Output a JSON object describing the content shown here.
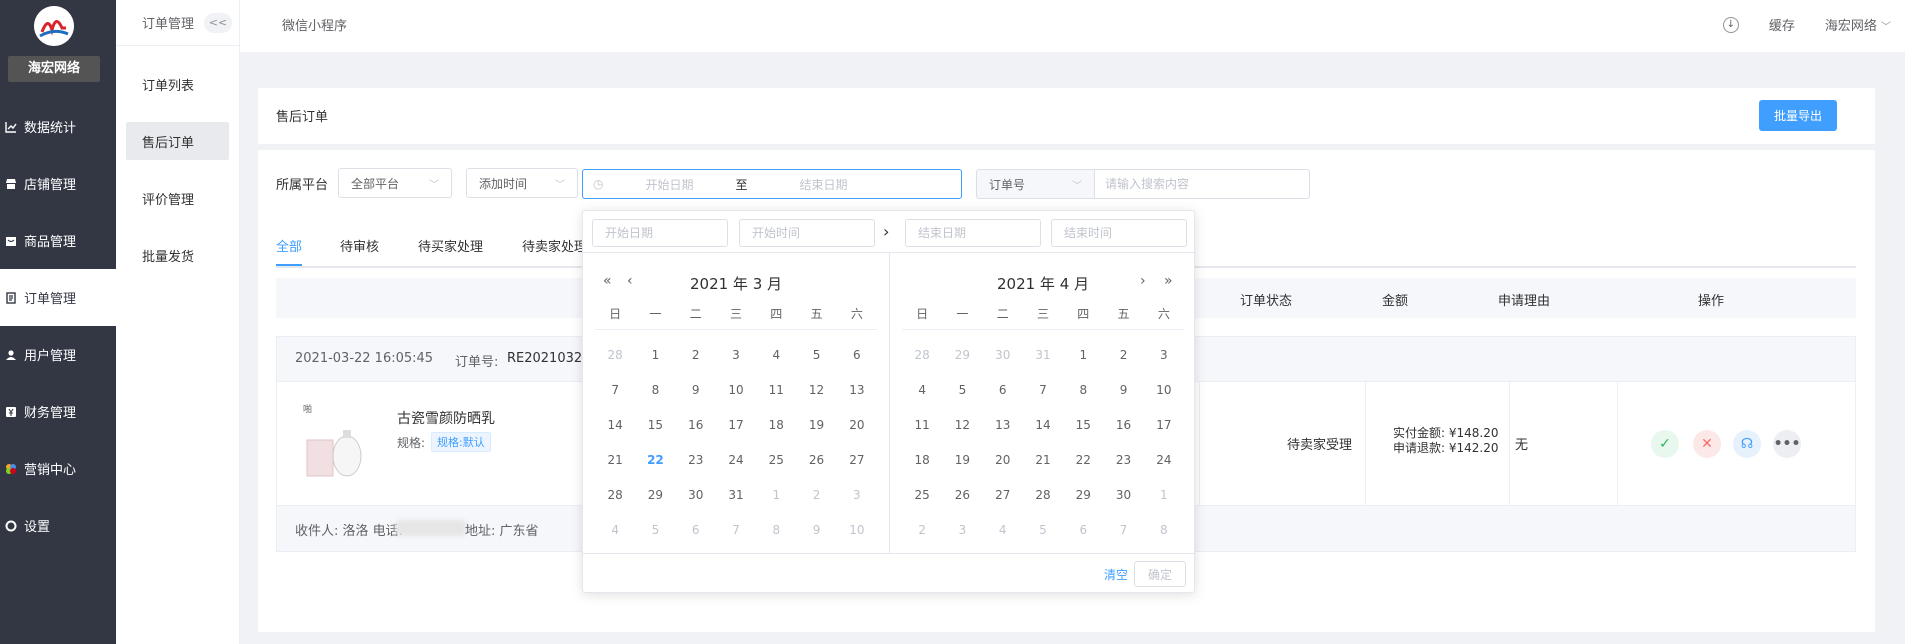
{
  "sidebar": {
    "brand": "海宏网络",
    "items": [
      {
        "label": "数据统计",
        "icon": "chart-icon"
      },
      {
        "label": "店铺管理",
        "icon": "store-icon"
      },
      {
        "label": "商品管理",
        "icon": "goods-icon"
      },
      {
        "label": "订单管理",
        "icon": "order-icon"
      },
      {
        "label": "用户管理",
        "icon": "user-icon"
      },
      {
        "label": "财务管理",
        "icon": "finance-icon"
      },
      {
        "label": "营销中心",
        "icon": "marketing-icon"
      },
      {
        "label": "设置",
        "icon": "settings-icon"
      }
    ],
    "active": "订单管理"
  },
  "subsidebar": {
    "title": "订单管理",
    "collapse": "<<",
    "items": [
      "订单列表",
      "售后订单",
      "评价管理",
      "批量发货"
    ],
    "active": "售后订单"
  },
  "topbar": {
    "miniprogram": "微信小程序",
    "cache": "缓存",
    "user": "海宏网络"
  },
  "header_card": {
    "title": "售后订单",
    "export": "批量导出"
  },
  "filters": {
    "platform_label": "所属平台",
    "platform_value": "全部平台",
    "time_type": "添加时间",
    "start_placeholder": "开始日期",
    "separator": "至",
    "end_placeholder": "结束日期",
    "order_field": "订单号",
    "search_placeholder": "请输入搜索内容"
  },
  "tabs": [
    "全部",
    "待审核",
    "待买家处理",
    "待卖家处理"
  ],
  "table": {
    "headers": {
      "status": "订单状态",
      "amount": "金额",
      "reason": "申请理由",
      "ops": "操作"
    }
  },
  "order": {
    "time": "2021-03-22 16:05:45",
    "no_label": "订单号:",
    "no_value": "RE2021032",
    "product_name": "古瓷雪颜防晒乳",
    "spec_label": "规格:",
    "spec_value": "规格:默认",
    "status": "待卖家受理",
    "paid": "实付金额: ¥148.20",
    "refund": "申请退款: ¥142.20",
    "reason": "无",
    "receiver": "收件人: 洛洛 电话:",
    "address": "地址: 广东省"
  },
  "picker": {
    "start_date": "开始日期",
    "start_time": "开始时间",
    "end_date": "结束日期",
    "end_time": "结束时间",
    "left_title": "2021 年 3 月",
    "right_title": "2021 年 4 月",
    "weekdays": [
      "日",
      "一",
      "二",
      "三",
      "四",
      "五",
      "六"
    ],
    "left_days": [
      [
        "28",
        "dim"
      ],
      [
        "1",
        ""
      ],
      [
        "2",
        ""
      ],
      [
        "3",
        ""
      ],
      [
        "4",
        ""
      ],
      [
        "5",
        ""
      ],
      [
        "6",
        ""
      ],
      [
        "7",
        ""
      ],
      [
        "8",
        ""
      ],
      [
        "9",
        ""
      ],
      [
        "10",
        ""
      ],
      [
        "11",
        ""
      ],
      [
        "12",
        ""
      ],
      [
        "13",
        ""
      ],
      [
        "14",
        ""
      ],
      [
        "15",
        ""
      ],
      [
        "16",
        ""
      ],
      [
        "17",
        ""
      ],
      [
        "18",
        ""
      ],
      [
        "19",
        ""
      ],
      [
        "20",
        ""
      ],
      [
        "21",
        ""
      ],
      [
        "22",
        "today"
      ],
      [
        "23",
        ""
      ],
      [
        "24",
        ""
      ],
      [
        "25",
        ""
      ],
      [
        "26",
        ""
      ],
      [
        "27",
        ""
      ],
      [
        "28",
        ""
      ],
      [
        "29",
        ""
      ],
      [
        "30",
        ""
      ],
      [
        "31",
        ""
      ],
      [
        "1",
        "dim"
      ],
      [
        "2",
        "dim"
      ],
      [
        "3",
        "dim"
      ],
      [
        "4",
        "dim"
      ],
      [
        "5",
        "dim"
      ],
      [
        "6",
        "dim"
      ],
      [
        "7",
        "dim"
      ],
      [
        "8",
        "dim"
      ],
      [
        "9",
        "dim"
      ],
      [
        "10",
        "dim"
      ]
    ],
    "right_days": [
      [
        "28",
        "dim"
      ],
      [
        "29",
        "dim"
      ],
      [
        "30",
        "dim"
      ],
      [
        "31",
        "dim"
      ],
      [
        "1",
        ""
      ],
      [
        "2",
        ""
      ],
      [
        "3",
        ""
      ],
      [
        "4",
        ""
      ],
      [
        "5",
        ""
      ],
      [
        "6",
        ""
      ],
      [
        "7",
        ""
      ],
      [
        "8",
        ""
      ],
      [
        "9",
        ""
      ],
      [
        "10",
        ""
      ],
      [
        "11",
        ""
      ],
      [
        "12",
        ""
      ],
      [
        "13",
        ""
      ],
      [
        "14",
        ""
      ],
      [
        "15",
        ""
      ],
      [
        "16",
        ""
      ],
      [
        "17",
        ""
      ],
      [
        "18",
        ""
      ],
      [
        "19",
        ""
      ],
      [
        "20",
        ""
      ],
      [
        "21",
        ""
      ],
      [
        "22",
        ""
      ],
      [
        "23",
        ""
      ],
      [
        "24",
        ""
      ],
      [
        "25",
        ""
      ],
      [
        "26",
        ""
      ],
      [
        "27",
        ""
      ],
      [
        "28",
        ""
      ],
      [
        "29",
        ""
      ],
      [
        "30",
        ""
      ],
      [
        "1",
        "dim"
      ],
      [
        "2",
        "dim"
      ],
      [
        "3",
        "dim"
      ],
      [
        "4",
        "dim"
      ],
      [
        "5",
        "dim"
      ],
      [
        "6",
        "dim"
      ],
      [
        "7",
        "dim"
      ],
      [
        "8",
        "dim"
      ]
    ],
    "clear": "清空",
    "confirm": "确定"
  },
  "colors": {
    "accent": "#409eff",
    "sidebar": "#333744"
  }
}
